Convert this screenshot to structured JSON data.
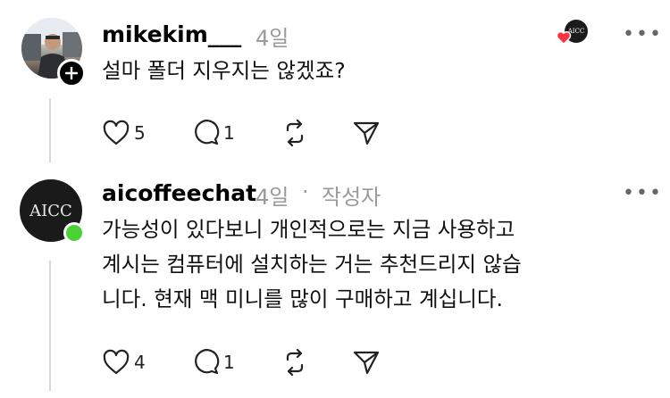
{
  "reply1": {
    "username": "mikekim___",
    "time": "4일",
    "text": "설마 폴더 지우지는 않겠죠?",
    "likes": "5",
    "comments": "1",
    "liked_by_badge": "AICC",
    "icons": [
      "heart-icon",
      "comment-icon",
      "repost-icon",
      "share-icon",
      "more-icon",
      "follow-plus-icon"
    ]
  },
  "reply2": {
    "username": "aicoffeechat",
    "time": "4일",
    "separator": "·",
    "author_tag": "작성자",
    "avatar_text": "AICC",
    "lines": [
      "가능성이 있다보니 개인적으로는 지금 사용하고",
      "계시는 컴퓨터에 설치하는 거는 추천드리지 않습",
      "니다. 현재 맥 미니를 많이 구매하고 계십니다."
    ],
    "likes": "4",
    "comments": "1",
    "online_color": "#4cd137"
  }
}
